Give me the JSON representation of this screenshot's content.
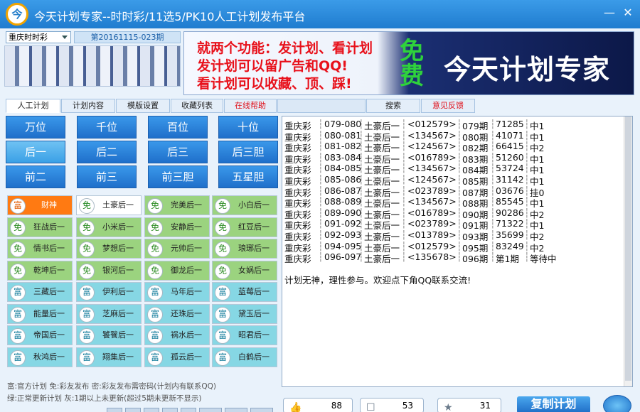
{
  "window": {
    "title": "今天计划专家--时时彩/11选5/PK10人工计划发布平台",
    "logo": "今",
    "minimize": "—",
    "close": "✕"
  },
  "lottery": {
    "selected": "重庆时时彩",
    "period": "第20161115-023期"
  },
  "banner": {
    "lines": [
      "就两个功能：发计划、看计划",
      "发计划可以留广告和QQ!",
      "看计划可以收藏、顶、踩!"
    ],
    "free": "免费",
    "brand": "今天计划专家"
  },
  "tabs": [
    "人工计划",
    "计划内容",
    "模版设置",
    "收藏列表",
    "在线帮助",
    "搜索",
    "意见反馈"
  ],
  "positions": [
    [
      "万位",
      "千位",
      "百位",
      "十位"
    ],
    [
      "后一",
      "后二",
      "后三",
      "后三胆"
    ],
    [
      "前二",
      "前三",
      "前三胆",
      "五星胆"
    ]
  ],
  "plans": [
    [
      {
        "icon": "富",
        "name": "财神"
      },
      {
        "icon": "免",
        "name": "土豪后一"
      },
      {
        "icon": "免",
        "name": "完美后一"
      },
      {
        "icon": "免",
        "name": "小白后一"
      }
    ],
    [
      {
        "icon": "免",
        "name": "狂战后一"
      },
      {
        "icon": "免",
        "name": "小米后一"
      },
      {
        "icon": "免",
        "name": "安静后一"
      },
      {
        "icon": "免",
        "name": "红豆后一"
      }
    ],
    [
      {
        "icon": "免",
        "name": "情书后一"
      },
      {
        "icon": "免",
        "name": "梦想后一"
      },
      {
        "icon": "免",
        "name": "元帅后一"
      },
      {
        "icon": "免",
        "name": "琅琊后一"
      }
    ],
    [
      {
        "icon": "免",
        "name": "乾坤后一"
      },
      {
        "icon": "免",
        "name": "银河后一"
      },
      {
        "icon": "免",
        "name": "御龙后一"
      },
      {
        "icon": "免",
        "name": "女娲后一"
      }
    ],
    [
      {
        "icon": "富",
        "name": "三藏后一"
      },
      {
        "icon": "富",
        "name": "伊利后一"
      },
      {
        "icon": "富",
        "name": "马年后一"
      },
      {
        "icon": "富",
        "name": "蓝莓后一"
      }
    ],
    [
      {
        "icon": "富",
        "name": "能量后一"
      },
      {
        "icon": "富",
        "name": "芝麻后一"
      },
      {
        "icon": "富",
        "name": "还珠后一"
      },
      {
        "icon": "富",
        "name": "黛玉后一"
      }
    ],
    [
      {
        "icon": "富",
        "name": "帝国后一"
      },
      {
        "icon": "富",
        "name": "饕餮后一"
      },
      {
        "icon": "富",
        "name": "祸水后一"
      },
      {
        "icon": "富",
        "name": "昭君后一"
      }
    ],
    [
      {
        "icon": "富",
        "name": "秋鸿后一"
      },
      {
        "icon": "富",
        "name": "翔集后一"
      },
      {
        "icon": "富",
        "name": "孤云后一"
      },
      {
        "icon": "富",
        "name": "白鹤后一"
      }
    ]
  ],
  "legend": [
    "富:官方计划  免:彩友发布  密:彩友发布需密码(计划内有联系QQ)",
    "绿:正常更新计划  灰:1期以上未更新(超过5期未更新不显示)"
  ],
  "results": {
    "rows": [
      [
        "重庆彩",
        "079-080",
        "土豪后一",
        "<012579>",
        "079期",
        "71285",
        "中1"
      ],
      [
        "重庆彩",
        "080-081",
        "土豪后一",
        "<134567>",
        "080期",
        "41071",
        "中1"
      ],
      [
        "重庆彩",
        "081-082",
        "土豪后一",
        "<124567>",
        "082期",
        "66415",
        "中2"
      ],
      [
        "重庆彩",
        "083-084",
        "土豪后一",
        "<016789>",
        "083期",
        "51260",
        "中1"
      ],
      [
        "重庆彩",
        "084-085",
        "土豪后一",
        "<134567>",
        "084期",
        "53724",
        "中1"
      ],
      [
        "重庆彩",
        "085-086",
        "土豪后一",
        "<124567>",
        "085期",
        "31142",
        "中1"
      ],
      [
        "重庆彩",
        "086-087",
        "土豪后一",
        "<023789>",
        "087期",
        "03676",
        "挂0"
      ],
      [
        "重庆彩",
        "088-089",
        "土豪后一",
        "<134567>",
        "088期",
        "85545",
        "中1"
      ],
      [
        "重庆彩",
        "089-090",
        "土豪后一",
        "<016789>",
        "090期",
        "90286",
        "中2"
      ],
      [
        "重庆彩",
        "091-092",
        "土豪后一",
        "<023789>",
        "091期",
        "71322",
        "中1"
      ],
      [
        "重庆彩",
        "092-093",
        "土豪后一",
        "<013789>",
        "093期",
        "35699",
        "中2"
      ],
      [
        "重庆彩",
        "094-095",
        "土豪后一",
        "<012579>",
        "095期",
        "83249",
        "中2"
      ],
      [
        "重庆彩",
        "096-097",
        "土豪后一",
        "<135678>",
        "096期",
        "第1期",
        "等待中"
      ]
    ],
    "note": "计划无神，理性参与。欢迎点下角QQ联系交流!"
  },
  "bottom": {
    "like": "88",
    "comment": "53",
    "star": "31",
    "copy": "复制计划"
  }
}
